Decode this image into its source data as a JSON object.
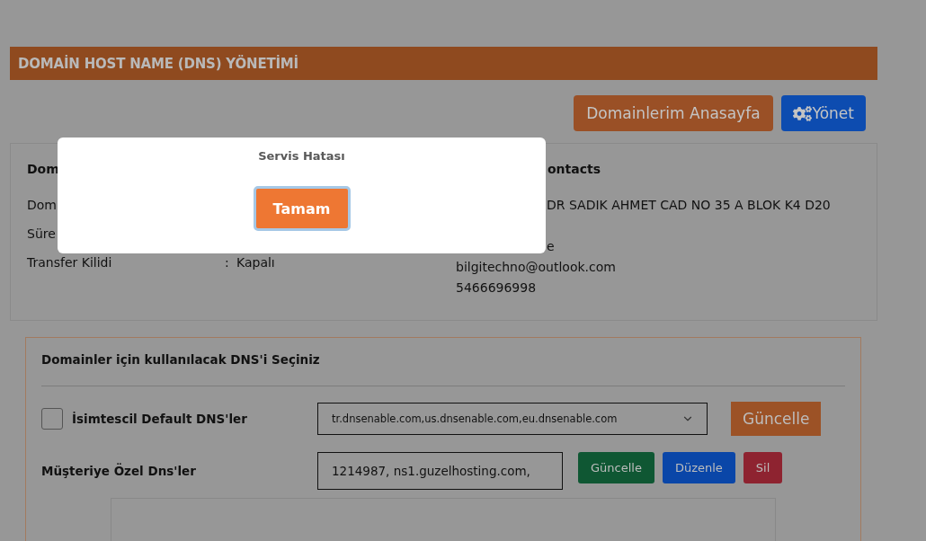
{
  "page_header": {
    "title": "DOMAİN HOST NAME (DNS) YÖNETİMİ"
  },
  "actions": [
    {
      "label": "Domainlerim Anasayfa",
      "kind": "home"
    },
    {
      "label": "Yönet",
      "kind": "manage"
    }
  ],
  "domain_info": {
    "heading": "Dom",
    "rows": [
      {
        "label": "Dom"
      },
      {
        "label": "Süre"
      },
      {
        "label": "Transfer Kilidi",
        "separator": ":",
        "value": "Kapalı"
      }
    ]
  },
  "contacts": {
    "heading": "ontacts",
    "partial_lines": [
      "DR SADIK AHMET CAD NO 35 A BLOK K4 D20",
      "e"
    ],
    "lines": [
      "bilgitechno@outlook.com",
      "5466696998"
    ]
  },
  "dns_section": {
    "heading": "Domainler için kullanılacak DNS'i Seçiniz",
    "options": [
      {
        "kind": "default",
        "label": "İsimtescil Default DNS'ler",
        "checked": false,
        "select_value": "tr.dnsenable.com,us.dnsenable.com,eu.dnsenable.com",
        "buttons": [
          {
            "label": "Güncelle",
            "color": "#9c5226"
          }
        ]
      },
      {
        "kind": "custom",
        "label": "Müşteriye Özel Dns'ler",
        "input_value": "1214987, ns1.guzelhosting.com,",
        "buttons": [
          {
            "label": "Güncelle",
            "color": "#0f5733"
          },
          {
            "label": "Düzenle",
            "color": "#0a46a8"
          },
          {
            "label": "Sil",
            "color": "#8e2330"
          }
        ]
      }
    ]
  },
  "dialog": {
    "title": "Servis Hatası",
    "button": "Tamam"
  }
}
